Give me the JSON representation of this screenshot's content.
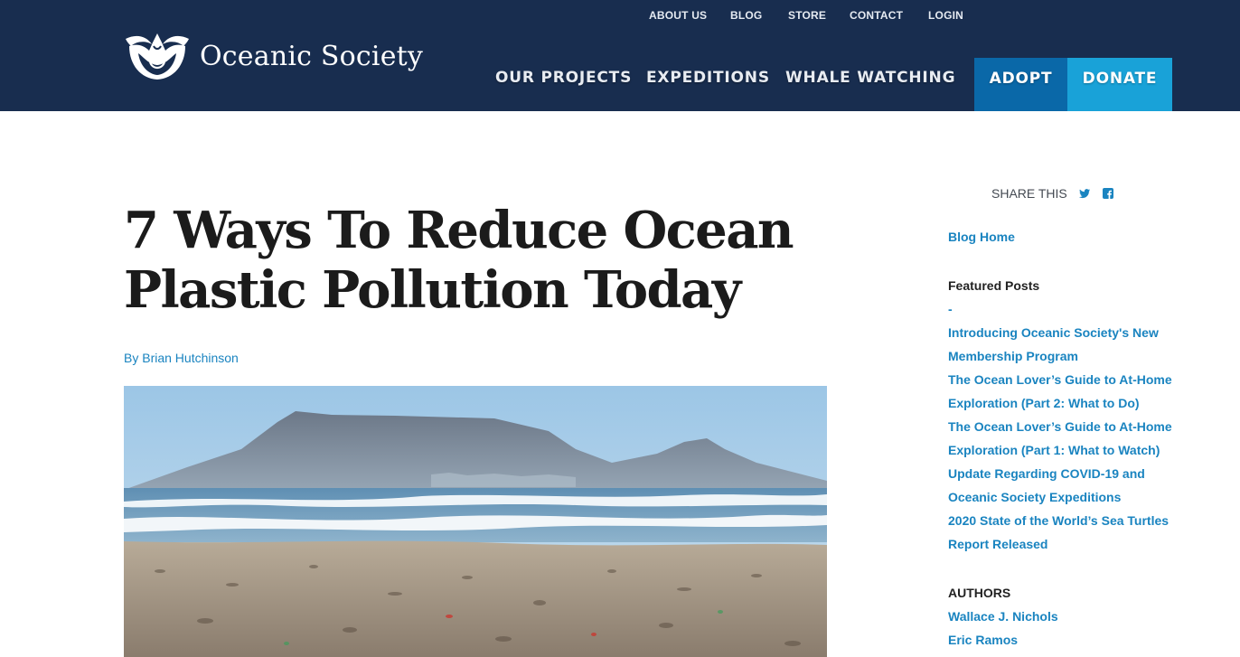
{
  "header": {
    "logo_text": "Oceanic Society",
    "util_nav": [
      "ABOUT US",
      "BLOG",
      "STORE",
      "CONTACT",
      "LOGIN"
    ],
    "main_nav": [
      "OUR PROJECTS",
      "EXPEDITIONS",
      "WHALE WATCHING"
    ],
    "adopt_label": "ADOPT",
    "donate_label": "DONATE"
  },
  "article": {
    "title": "7 Ways To Reduce Ocean Plastic Pollution Today",
    "byline": "By Brian Hutchinson"
  },
  "sidebar": {
    "share_label": "SHARE THIS",
    "share_icons": [
      "twitter-icon",
      "facebook-icon"
    ],
    "blog_home": "Blog Home",
    "featured_heading": "Featured Posts",
    "featured_posts": [
      "-",
      "Introducing Oceanic Society's New Membership Program",
      "The Ocean Lover’s Guide to At-Home Exploration (Part 2: What to Do)",
      "The Ocean Lover’s Guide to At-Home Exploration (Part 1: What to Watch)",
      "Update Regarding COVID-19 and Oceanic Society Expeditions",
      "2020 State of the World’s Sea Turtles Report Released"
    ],
    "authors_heading": "AUTHORS",
    "authors": [
      "Wallace J. Nichols",
      "Eric Ramos"
    ]
  },
  "colors": {
    "header_bg": "#182d4f",
    "adopt_bg": "#0a68a8",
    "donate_bg": "#19a2d8",
    "link": "#1a84c0"
  }
}
